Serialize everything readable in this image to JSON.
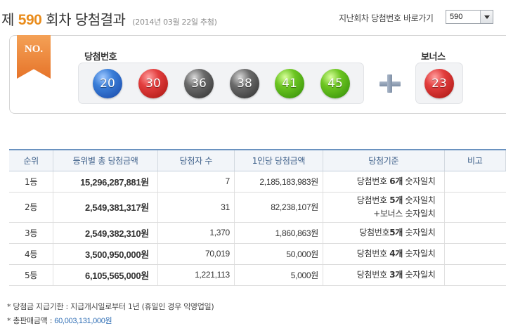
{
  "header": {
    "prefix": "제",
    "round": "590",
    "suffix": "회차 당첨결과",
    "draw_date": "(2014년 03월 22일 추첨)",
    "shortcut_label": "지난회차 당첨번호 바로가기",
    "round_select": "590"
  },
  "balls_section": {
    "badge": "NO.",
    "winning_label": "당첨번호",
    "bonus_label": "보너스",
    "numbers": [
      {
        "value": "20",
        "color": "#2f6fd0"
      },
      {
        "value": "30",
        "color": "#d93232"
      },
      {
        "value": "36",
        "color": "#5a5a5a"
      },
      {
        "value": "38",
        "color": "#5a5a5a"
      },
      {
        "value": "41",
        "color": "#5cb31c"
      },
      {
        "value": "45",
        "color": "#5cb31c"
      }
    ],
    "bonus": {
      "value": "23",
      "color": "#d93232"
    }
  },
  "table": {
    "headers": [
      "순위",
      "등위별 총 당첨금액",
      "당첨자 수",
      "1인당 당첨금액",
      "당첨기준",
      "비고"
    ],
    "rows": [
      {
        "rank": "1등",
        "total": "15,296,287,881원",
        "winners": "7",
        "per_person": "2,185,183,983원",
        "criteria_pre": "당첨번호 ",
        "criteria_bold": "6개",
        "criteria_post": " 숫자일치",
        "criteria_line2": ""
      },
      {
        "rank": "2등",
        "total": "2,549,381,317원",
        "winners": "31",
        "per_person": "82,238,107원",
        "criteria_pre": "당첨번호 ",
        "criteria_bold": "5개",
        "criteria_post": " 숫자일치",
        "criteria_line2": "+보너스 숫자일치"
      },
      {
        "rank": "3등",
        "total": "2,549,382,310원",
        "winners": "1,370",
        "per_person": "1,860,863원",
        "criteria_pre": "당첨번호",
        "criteria_bold": "5개",
        "criteria_post": " 숫자일치",
        "criteria_line2": ""
      },
      {
        "rank": "4등",
        "total": "3,500,950,000원",
        "winners": "70,019",
        "per_person": "50,000원",
        "criteria_pre": "당첨번호 ",
        "criteria_bold": "4개",
        "criteria_post": " 숫자일치",
        "criteria_line2": ""
      },
      {
        "rank": "5등",
        "total": "6,105,565,000원",
        "winners": "1,221,113",
        "per_person": "5,000원",
        "criteria_pre": "당첨번호 ",
        "criteria_bold": "3개",
        "criteria_post": " 숫자일치",
        "criteria_line2": ""
      }
    ]
  },
  "notes": {
    "payout_period": "* 당첨금 지급기한 : 지급개시일로부터 1년 (휴일인 경우 익영업일)",
    "sales_label": "* 총판매금액 : ",
    "sales_value": "60,003,131,000원"
  }
}
